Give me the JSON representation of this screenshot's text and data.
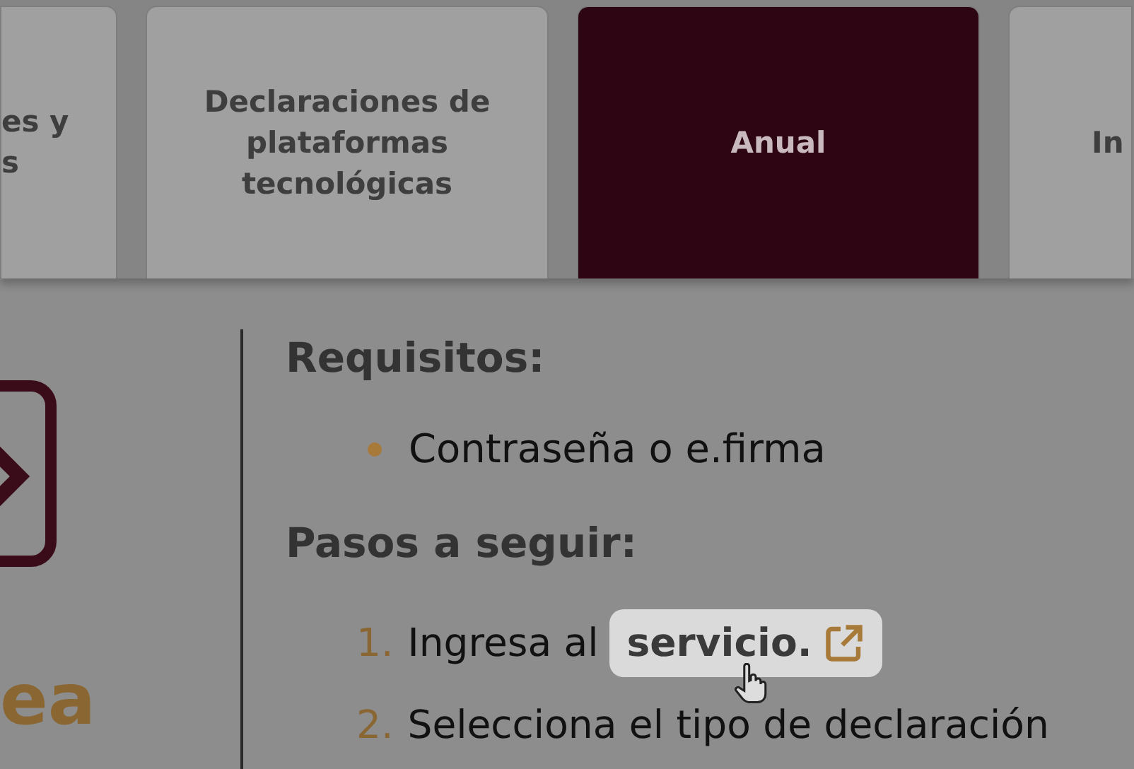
{
  "tabs": [
    {
      "label": "es y\ns",
      "selected": false
    },
    {
      "label": "Declaraciones de plataformas tecnológicas",
      "selected": false
    },
    {
      "label": "Anual",
      "selected": true
    },
    {
      "label": "In",
      "selected": false
    }
  ],
  "side": {
    "title": "ea"
  },
  "requirements": {
    "heading": "Requisitos:",
    "items": [
      "Contraseña o e.firma"
    ]
  },
  "steps": {
    "heading": "Pasos a seguir:",
    "items": [
      {
        "number": "1.",
        "text": "Ingresa al",
        "link": {
          "label": "servicio.",
          "highlighted": true
        }
      },
      {
        "number": "2.",
        "text": "Selecciona el tipo de declaración"
      }
    ]
  }
}
